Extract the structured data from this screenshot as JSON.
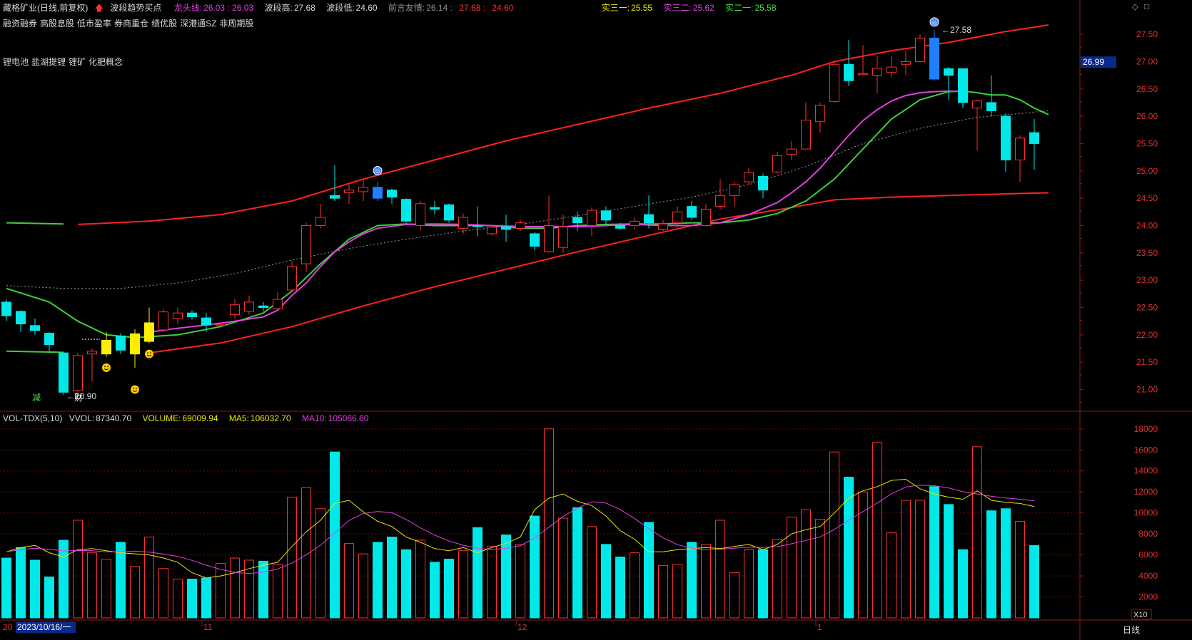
{
  "header": {
    "stock_name": "藏格矿业(日线,前复权)",
    "signal_label": "波段趋势买点",
    "dragon_label": "龙头线:",
    "dragon_val": "26.03 : 26.03",
    "wave_high_label": "波段高:",
    "wave_high_val": "27.68",
    "wave_low_label": "波段低:",
    "wave_low_val": "24.60",
    "advice_label": "前言友情:",
    "advice_v1": "26.14",
    "advice_v2": "27.68",
    "advice_v3": "24.60",
    "s31_label": "实三一:",
    "s31_val": "25.55",
    "s32_label": "实三二:",
    "s32_val": "25.62",
    "s21_label": "实二一:",
    "s21_val": "25.58",
    "icon_names": [
      "up-arrow-icon",
      "diamond-icon",
      "square-icon"
    ]
  },
  "tags_row1": [
    "融资融券",
    "高股息股",
    "低市盈率",
    "券商重仓",
    "绩优股",
    "深港通SZ",
    "非周期股"
  ],
  "tags_row2": [
    "锂电池",
    "盐湖提锂",
    "锂矿",
    "化肥概念"
  ],
  "price_axis": {
    "ticks": [
      "27.50",
      "27.00",
      "26.50",
      "26.00",
      "25.50",
      "25.00",
      "24.50",
      "24.00",
      "23.50",
      "23.00",
      "22.50",
      "22.00",
      "21.50",
      "21.00"
    ],
    "current_price": "26.99",
    "high_marker": "27.58",
    "low_marker": "20.90"
  },
  "volume_header": {
    "name": "VOL-TDX(5,10)",
    "vvol_label": "VVOL:",
    "vvol_val": "87340.70",
    "volume_label": "VOLUME:",
    "volume_val": "69009.94",
    "ma5_label": "MA5:",
    "ma5_val": "106032.70",
    "ma10_label": "MA10:",
    "ma10_val": "105066.60"
  },
  "volume_axis": {
    "ticks": [
      "18000",
      "16000",
      "14000",
      "12000",
      "10000",
      "8000",
      "6000",
      "4000",
      "2000"
    ],
    "unit": "X10"
  },
  "time_axis": {
    "date_label": "2023/10/16/一",
    "prefix": "20",
    "month_labels": [
      "11",
      "12",
      "1"
    ]
  },
  "event_markers": [
    "减",
    "财"
  ],
  "period_label": "日线",
  "colors": {
    "up": "#ff3030",
    "down": "#00e8e8",
    "yellow": "#ffee00",
    "blue": "#1e7fff",
    "magenta": "#e040e0",
    "green": "#3ad03a",
    "channel": "#ff2020"
  },
  "chart_data": {
    "type": "candlestick",
    "y_range": [
      20.72,
      27.84
    ],
    "volume_range": [
      0,
      18800
    ],
    "candles": [
      {
        "o": 22.6,
        "c": 22.35,
        "h": 22.65,
        "l": 22.25,
        "v": 5700,
        "k": "d"
      },
      {
        "o": 22.43,
        "c": 22.2,
        "h": 22.45,
        "l": 22.05,
        "v": 6700,
        "k": "d"
      },
      {
        "o": 22.17,
        "c": 22.08,
        "h": 22.3,
        "l": 22.0,
        "v": 5500,
        "k": "d"
      },
      {
        "o": 22.03,
        "c": 21.82,
        "h": 22.05,
        "l": 21.7,
        "v": 3900,
        "k": "d"
      },
      {
        "o": 21.67,
        "c": 20.95,
        "h": 21.68,
        "l": 20.9,
        "v": 7400,
        "k": "d"
      },
      {
        "o": 21.62,
        "c": 20.98,
        "h": 21.67,
        "l": 20.95,
        "v": 9300,
        "k": "u"
      },
      {
        "o": 21.65,
        "c": 21.7,
        "h": 21.75,
        "l": 21.15,
        "v": 6200,
        "k": "u"
      },
      {
        "o": 21.65,
        "c": 21.9,
        "h": 22.05,
        "l": 21.6,
        "v": 5600,
        "k": "y"
      },
      {
        "o": 21.98,
        "c": 21.72,
        "h": 22.03,
        "l": 21.65,
        "v": 7200,
        "k": "d"
      },
      {
        "o": 21.65,
        "c": 22.02,
        "h": 22.1,
        "l": 21.4,
        "v": 4900,
        "k": "y"
      },
      {
        "o": 21.88,
        "c": 22.22,
        "h": 22.5,
        "l": 21.85,
        "v": 7700,
        "k": "y"
      },
      {
        "o": 22.09,
        "c": 22.42,
        "h": 22.47,
        "l": 22.05,
        "v": 4700,
        "k": "u"
      },
      {
        "o": 22.3,
        "c": 22.4,
        "h": 22.5,
        "l": 22.2,
        "v": 3700,
        "k": "u"
      },
      {
        "o": 22.4,
        "c": 22.33,
        "h": 22.45,
        "l": 22.28,
        "v": 3700,
        "k": "d"
      },
      {
        "o": 22.31,
        "c": 22.18,
        "h": 22.4,
        "l": 22.05,
        "v": 3800,
        "k": "d"
      },
      {
        "o": 22.19,
        "c": 22.18,
        "h": 22.22,
        "l": 22.14,
        "v": 5200,
        "k": "u"
      },
      {
        "o": 22.37,
        "c": 22.55,
        "h": 22.65,
        "l": 22.3,
        "v": 5700,
        "k": "u"
      },
      {
        "o": 22.43,
        "c": 22.6,
        "h": 22.72,
        "l": 22.37,
        "v": 5500,
        "k": "u"
      },
      {
        "o": 22.53,
        "c": 22.5,
        "h": 22.6,
        "l": 22.43,
        "v": 5400,
        "k": "d"
      },
      {
        "o": 22.48,
        "c": 22.65,
        "h": 22.78,
        "l": 22.43,
        "v": 5100,
        "k": "u"
      },
      {
        "o": 22.82,
        "c": 23.25,
        "h": 23.35,
        "l": 22.78,
        "v": 11500,
        "k": "u"
      },
      {
        "o": 23.3,
        "c": 24.0,
        "h": 24.05,
        "l": 23.15,
        "v": 12400,
        "k": "u"
      },
      {
        "o": 24.0,
        "c": 24.15,
        "h": 24.4,
        "l": 23.95,
        "v": 10400,
        "k": "u"
      },
      {
        "o": 24.5,
        "c": 24.55,
        "h": 25.1,
        "l": 24.45,
        "v": 15800,
        "k": "d"
      },
      {
        "o": 24.6,
        "c": 24.65,
        "h": 24.75,
        "l": 24.4,
        "v": 7100,
        "k": "u"
      },
      {
        "o": 24.62,
        "c": 24.7,
        "h": 24.85,
        "l": 24.45,
        "v": 6100,
        "k": "u"
      },
      {
        "o": 24.7,
        "c": 24.5,
        "h": 24.8,
        "l": 24.45,
        "v": 7200,
        "k": "b"
      },
      {
        "o": 24.65,
        "c": 24.52,
        "h": 24.68,
        "l": 24.4,
        "v": 7700,
        "k": "d"
      },
      {
        "o": 24.48,
        "c": 24.08,
        "h": 24.5,
        "l": 24.05,
        "v": 6500,
        "k": "d"
      },
      {
        "o": 24.0,
        "c": 24.4,
        "h": 24.45,
        "l": 23.9,
        "v": 7400,
        "k": "u"
      },
      {
        "o": 24.33,
        "c": 24.3,
        "h": 24.45,
        "l": 24.2,
        "v": 5300,
        "k": "d"
      },
      {
        "o": 24.38,
        "c": 24.1,
        "h": 24.4,
        "l": 24.05,
        "v": 5600,
        "k": "d"
      },
      {
        "o": 23.95,
        "c": 24.15,
        "h": 24.22,
        "l": 23.85,
        "v": 6400,
        "k": "u"
      },
      {
        "o": 24.0,
        "c": 24.0,
        "h": 24.35,
        "l": 23.8,
        "v": 8600,
        "k": "d"
      },
      {
        "o": 23.85,
        "c": 23.97,
        "h": 24.02,
        "l": 23.82,
        "v": 6800,
        "k": "u"
      },
      {
        "o": 23.98,
        "c": 23.93,
        "h": 24.2,
        "l": 23.7,
        "v": 7900,
        "k": "d"
      },
      {
        "o": 23.95,
        "c": 24.05,
        "h": 24.1,
        "l": 23.9,
        "v": 7000,
        "k": "u"
      },
      {
        "o": 23.85,
        "c": 23.62,
        "h": 23.88,
        "l": 23.55,
        "v": 9700,
        "k": "d"
      },
      {
        "o": 23.52,
        "c": 24.0,
        "h": 24.55,
        "l": 23.5,
        "v": 18000,
        "k": "u"
      },
      {
        "o": 23.6,
        "c": 23.98,
        "h": 24.2,
        "l": 23.5,
        "v": 9500,
        "k": "u"
      },
      {
        "o": 24.15,
        "c": 24.05,
        "h": 24.25,
        "l": 23.9,
        "v": 10500,
        "k": "d"
      },
      {
        "o": 24.0,
        "c": 24.28,
        "h": 24.33,
        "l": 23.8,
        "v": 8700,
        "k": "u"
      },
      {
        "o": 24.27,
        "c": 24.1,
        "h": 24.35,
        "l": 24.0,
        "v": 7000,
        "k": "d"
      },
      {
        "o": 24.0,
        "c": 23.95,
        "h": 24.05,
        "l": 23.92,
        "v": 5800,
        "k": "d"
      },
      {
        "o": 24.0,
        "c": 24.08,
        "h": 24.15,
        "l": 23.93,
        "v": 6200,
        "k": "u"
      },
      {
        "o": 24.2,
        "c": 24.05,
        "h": 24.55,
        "l": 23.95,
        "v": 9100,
        "k": "d"
      },
      {
        "o": 23.93,
        "c": 24.03,
        "h": 24.1,
        "l": 23.9,
        "v": 5000,
        "k": "u"
      },
      {
        "o": 24.05,
        "c": 24.25,
        "h": 24.35,
        "l": 23.95,
        "v": 5100,
        "k": "u"
      },
      {
        "o": 24.35,
        "c": 24.15,
        "h": 24.45,
        "l": 24.1,
        "v": 7200,
        "k": "d"
      },
      {
        "o": 24.0,
        "c": 24.3,
        "h": 24.4,
        "l": 23.98,
        "v": 7000,
        "k": "u"
      },
      {
        "o": 24.35,
        "c": 24.55,
        "h": 24.85,
        "l": 24.3,
        "v": 9300,
        "k": "u"
      },
      {
        "o": 24.55,
        "c": 24.75,
        "h": 24.8,
        "l": 24.35,
        "v": 4300,
        "k": "u"
      },
      {
        "o": 24.8,
        "c": 24.97,
        "h": 25.05,
        "l": 24.75,
        "v": 6500,
        "k": "u"
      },
      {
        "o": 24.9,
        "c": 24.65,
        "h": 24.95,
        "l": 24.5,
        "v": 6500,
        "k": "d"
      },
      {
        "o": 24.98,
        "c": 25.28,
        "h": 25.35,
        "l": 24.95,
        "v": 7500,
        "k": "u"
      },
      {
        "o": 25.3,
        "c": 25.4,
        "h": 25.55,
        "l": 25.2,
        "v": 9600,
        "k": "u"
      },
      {
        "o": 25.4,
        "c": 25.93,
        "h": 26.25,
        "l": 25.4,
        "v": 10300,
        "k": "u"
      },
      {
        "o": 25.9,
        "c": 26.2,
        "h": 26.25,
        "l": 25.7,
        "v": 9400,
        "k": "u"
      },
      {
        "o": 26.27,
        "c": 26.95,
        "h": 26.99,
        "l": 26.25,
        "v": 15800,
        "k": "u"
      },
      {
        "o": 26.95,
        "c": 26.65,
        "h": 27.4,
        "l": 26.55,
        "v": 13400,
        "k": "d"
      },
      {
        "o": 26.77,
        "c": 26.78,
        "h": 27.3,
        "l": 26.75,
        "v": 12000,
        "k": "u"
      },
      {
        "o": 26.75,
        "c": 26.88,
        "h": 27.1,
        "l": 26.42,
        "v": 16700,
        "k": "u"
      },
      {
        "o": 26.8,
        "c": 26.9,
        "h": 27.1,
        "l": 26.72,
        "v": 8100,
        "k": "u"
      },
      {
        "o": 26.95,
        "c": 27.0,
        "h": 27.2,
        "l": 26.75,
        "v": 11200,
        "k": "u"
      },
      {
        "o": 27.0,
        "c": 27.43,
        "h": 27.5,
        "l": 26.98,
        "v": 11200,
        "k": "u"
      },
      {
        "o": 27.43,
        "c": 26.68,
        "h": 27.58,
        "l": 26.65,
        "v": 12500,
        "k": "b"
      },
      {
        "o": 26.87,
        "c": 26.75,
        "h": 26.9,
        "l": 26.3,
        "v": 10800,
        "k": "d"
      },
      {
        "o": 26.87,
        "c": 26.25,
        "h": 26.87,
        "l": 26.15,
        "v": 6500,
        "k": "d"
      },
      {
        "o": 26.28,
        "c": 26.15,
        "h": 26.3,
        "l": 25.37,
        "v": 16300,
        "k": "u"
      },
      {
        "o": 26.25,
        "c": 26.1,
        "h": 26.75,
        "l": 26.0,
        "v": 10200,
        "k": "d"
      },
      {
        "o": 26.0,
        "c": 25.2,
        "h": 26.05,
        "l": 24.98,
        "v": 10400,
        "k": "d"
      },
      {
        "o": 25.2,
        "c": 25.6,
        "h": 25.65,
        "l": 24.8,
        "v": 9200,
        "k": "u"
      },
      {
        "o": 25.7,
        "c": 25.5,
        "h": 25.95,
        "l": 25.02,
        "v": 6900,
        "k": "d"
      }
    ],
    "ma_dragon": [
      [
        0,
        22.85
      ],
      [
        3,
        22.6
      ],
      [
        5,
        22.25
      ],
      [
        7,
        22.0
      ],
      [
        9,
        21.95
      ],
      [
        12,
        22.0
      ],
      [
        15,
        22.15
      ],
      [
        18,
        22.4
      ],
      [
        20,
        22.8
      ],
      [
        22,
        23.3
      ],
      [
        24,
        23.75
      ],
      [
        26,
        24.0
      ],
      [
        28,
        24.03
      ],
      [
        30,
        24.0
      ],
      [
        32,
        24.0
      ],
      [
        34,
        24.0
      ],
      [
        36,
        23.95
      ],
      [
        38,
        23.95
      ],
      [
        40,
        24.0
      ],
      [
        42,
        24.02
      ],
      [
        44,
        24.03
      ],
      [
        46,
        24.03
      ],
      [
        48,
        24.05
      ],
      [
        50,
        24.05
      ],
      [
        52,
        24.1
      ],
      [
        54,
        24.22
      ],
      [
        56,
        24.45
      ],
      [
        58,
        24.85
      ],
      [
        60,
        25.4
      ],
      [
        62,
        25.95
      ],
      [
        64,
        26.3
      ],
      [
        66,
        26.45
      ],
      [
        67,
        26.46
      ],
      [
        68,
        26.43
      ],
      [
        69,
        26.39
      ],
      [
        70,
        26.39
      ],
      [
        71,
        26.3
      ],
      [
        72,
        26.15
      ],
      [
        73,
        26.03
      ]
    ],
    "ma_magenta": [
      [
        10,
        22.05
      ],
      [
        12,
        22.12
      ],
      [
        14,
        22.18
      ],
      [
        16,
        22.25
      ],
      [
        18,
        22.33
      ],
      [
        19,
        22.45
      ],
      [
        20,
        22.72
      ],
      [
        21,
        22.95
      ],
      [
        22,
        23.25
      ],
      [
        23,
        23.52
      ],
      [
        24,
        23.7
      ],
      [
        25,
        23.85
      ],
      [
        26,
        23.95
      ],
      [
        28,
        24.02
      ],
      [
        30,
        24.03
      ],
      [
        32,
        24.02
      ],
      [
        34,
        24.0
      ],
      [
        36,
        23.98
      ],
      [
        38,
        23.98
      ],
      [
        40,
        23.98
      ],
      [
        42,
        24.0
      ],
      [
        44,
        24.02
      ],
      [
        46,
        24.0
      ],
      [
        48,
        24.0
      ],
      [
        50,
        24.05
      ],
      [
        52,
        24.2
      ],
      [
        54,
        24.42
      ],
      [
        55,
        24.6
      ],
      [
        56,
        24.8
      ],
      [
        57,
        25.05
      ],
      [
        58,
        25.35
      ],
      [
        59,
        25.65
      ],
      [
        60,
        25.92
      ],
      [
        61,
        26.12
      ],
      [
        62,
        26.28
      ],
      [
        63,
        26.38
      ],
      [
        64,
        26.43
      ],
      [
        65,
        26.45
      ],
      [
        66,
        26.46
      ],
      [
        67,
        26.45
      ]
    ],
    "ma_gray": [
      [
        0,
        22.9
      ],
      [
        4,
        22.85
      ],
      [
        8,
        22.85
      ],
      [
        12,
        22.95
      ],
      [
        16,
        23.12
      ],
      [
        20,
        23.37
      ],
      [
        24,
        23.58
      ],
      [
        28,
        23.75
      ],
      [
        32,
        23.9
      ],
      [
        36,
        24.02
      ],
      [
        40,
        24.18
      ],
      [
        44,
        24.35
      ],
      [
        48,
        24.52
      ],
      [
        52,
        24.75
      ],
      [
        56,
        25.08
      ],
      [
        60,
        25.5
      ],
      [
        64,
        25.78
      ],
      [
        68,
        25.98
      ],
      [
        71,
        26.05
      ],
      [
        73,
        26.1
      ]
    ],
    "channel_upper": [
      [
        5,
        24.02
      ],
      [
        10,
        24.08
      ],
      [
        15,
        24.2
      ],
      [
        20,
        24.45
      ],
      [
        25,
        24.85
      ],
      [
        30,
        25.2
      ],
      [
        35,
        25.55
      ],
      [
        40,
        25.85
      ],
      [
        45,
        26.15
      ],
      [
        50,
        26.42
      ],
      [
        55,
        26.75
      ],
      [
        58,
        27.0
      ],
      [
        62,
        27.2
      ],
      [
        66,
        27.35
      ],
      [
        70,
        27.55
      ],
      [
        73,
        27.67
      ]
    ],
    "channel_lower": [
      [
        10,
        21.67
      ],
      [
        15,
        21.85
      ],
      [
        20,
        22.15
      ],
      [
        25,
        22.53
      ],
      [
        30,
        22.88
      ],
      [
        35,
        23.2
      ],
      [
        40,
        23.52
      ],
      [
        45,
        23.82
      ],
      [
        50,
        24.12
      ],
      [
        55,
        24.33
      ],
      [
        58,
        24.47
      ],
      [
        62,
        24.52
      ],
      [
        66,
        24.55
      ],
      [
        70,
        24.58
      ],
      [
        73,
        24.6
      ]
    ],
    "green_left_top": [
      [
        0,
        24.05
      ],
      [
        4,
        24.03
      ]
    ],
    "green_left_bottom": [
      [
        0,
        21.7
      ],
      [
        4,
        21.68
      ]
    ],
    "vol_ma5": [
      6300,
      6700,
      6900,
      6200,
      5800,
      6500,
      6600,
      6400,
      6200,
      6100,
      6000,
      5700,
      5300,
      4300,
      3800,
      4000,
      4300,
      4700,
      5000,
      5300,
      6800,
      8200,
      9300,
      10900,
      11200,
      10100,
      9200,
      8700,
      7700,
      7200,
      6600,
      6400,
      6700,
      6200,
      6700,
      7100,
      7700,
      10300,
      11400,
      11800,
      11100,
      10700,
      9700,
      8300,
      7500,
      6300,
      6300,
      6500,
      6600,
      6700,
      6600,
      6800,
      7000,
      6500,
      7000,
      8000,
      8400,
      8700,
      10000,
      11400,
      12100,
      12500,
      13100,
      13200,
      12300,
      11800,
      11500,
      11300,
      12100,
      11200,
      11000,
      10900,
      10600
    ]
  }
}
